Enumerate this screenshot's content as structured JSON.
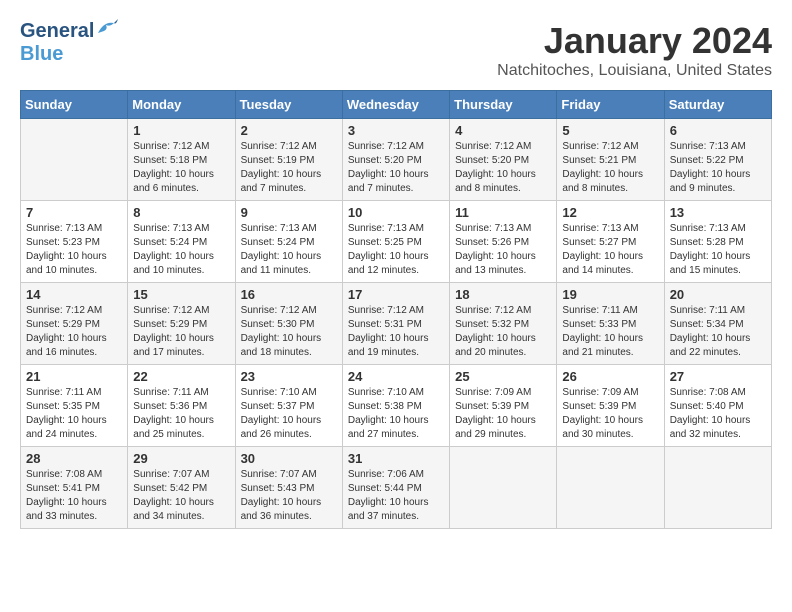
{
  "header": {
    "logo_general": "General",
    "logo_blue": "Blue",
    "month_title": "January 2024",
    "location": "Natchitoches, Louisiana, United States"
  },
  "weekdays": [
    "Sunday",
    "Monday",
    "Tuesday",
    "Wednesday",
    "Thursday",
    "Friday",
    "Saturday"
  ],
  "weeks": [
    [
      {
        "day": "",
        "info": ""
      },
      {
        "day": "1",
        "info": "Sunrise: 7:12 AM\nSunset: 5:18 PM\nDaylight: 10 hours\nand 6 minutes."
      },
      {
        "day": "2",
        "info": "Sunrise: 7:12 AM\nSunset: 5:19 PM\nDaylight: 10 hours\nand 7 minutes."
      },
      {
        "day": "3",
        "info": "Sunrise: 7:12 AM\nSunset: 5:20 PM\nDaylight: 10 hours\nand 7 minutes."
      },
      {
        "day": "4",
        "info": "Sunrise: 7:12 AM\nSunset: 5:20 PM\nDaylight: 10 hours\nand 8 minutes."
      },
      {
        "day": "5",
        "info": "Sunrise: 7:12 AM\nSunset: 5:21 PM\nDaylight: 10 hours\nand 8 minutes."
      },
      {
        "day": "6",
        "info": "Sunrise: 7:13 AM\nSunset: 5:22 PM\nDaylight: 10 hours\nand 9 minutes."
      }
    ],
    [
      {
        "day": "7",
        "info": "Sunrise: 7:13 AM\nSunset: 5:23 PM\nDaylight: 10 hours\nand 10 minutes."
      },
      {
        "day": "8",
        "info": "Sunrise: 7:13 AM\nSunset: 5:24 PM\nDaylight: 10 hours\nand 10 minutes."
      },
      {
        "day": "9",
        "info": "Sunrise: 7:13 AM\nSunset: 5:24 PM\nDaylight: 10 hours\nand 11 minutes."
      },
      {
        "day": "10",
        "info": "Sunrise: 7:13 AM\nSunset: 5:25 PM\nDaylight: 10 hours\nand 12 minutes."
      },
      {
        "day": "11",
        "info": "Sunrise: 7:13 AM\nSunset: 5:26 PM\nDaylight: 10 hours\nand 13 minutes."
      },
      {
        "day": "12",
        "info": "Sunrise: 7:13 AM\nSunset: 5:27 PM\nDaylight: 10 hours\nand 14 minutes."
      },
      {
        "day": "13",
        "info": "Sunrise: 7:13 AM\nSunset: 5:28 PM\nDaylight: 10 hours\nand 15 minutes."
      }
    ],
    [
      {
        "day": "14",
        "info": "Sunrise: 7:12 AM\nSunset: 5:29 PM\nDaylight: 10 hours\nand 16 minutes."
      },
      {
        "day": "15",
        "info": "Sunrise: 7:12 AM\nSunset: 5:29 PM\nDaylight: 10 hours\nand 17 minutes."
      },
      {
        "day": "16",
        "info": "Sunrise: 7:12 AM\nSunset: 5:30 PM\nDaylight: 10 hours\nand 18 minutes."
      },
      {
        "day": "17",
        "info": "Sunrise: 7:12 AM\nSunset: 5:31 PM\nDaylight: 10 hours\nand 19 minutes."
      },
      {
        "day": "18",
        "info": "Sunrise: 7:12 AM\nSunset: 5:32 PM\nDaylight: 10 hours\nand 20 minutes."
      },
      {
        "day": "19",
        "info": "Sunrise: 7:11 AM\nSunset: 5:33 PM\nDaylight: 10 hours\nand 21 minutes."
      },
      {
        "day": "20",
        "info": "Sunrise: 7:11 AM\nSunset: 5:34 PM\nDaylight: 10 hours\nand 22 minutes."
      }
    ],
    [
      {
        "day": "21",
        "info": "Sunrise: 7:11 AM\nSunset: 5:35 PM\nDaylight: 10 hours\nand 24 minutes."
      },
      {
        "day": "22",
        "info": "Sunrise: 7:11 AM\nSunset: 5:36 PM\nDaylight: 10 hours\nand 25 minutes."
      },
      {
        "day": "23",
        "info": "Sunrise: 7:10 AM\nSunset: 5:37 PM\nDaylight: 10 hours\nand 26 minutes."
      },
      {
        "day": "24",
        "info": "Sunrise: 7:10 AM\nSunset: 5:38 PM\nDaylight: 10 hours\nand 27 minutes."
      },
      {
        "day": "25",
        "info": "Sunrise: 7:09 AM\nSunset: 5:39 PM\nDaylight: 10 hours\nand 29 minutes."
      },
      {
        "day": "26",
        "info": "Sunrise: 7:09 AM\nSunset: 5:39 PM\nDaylight: 10 hours\nand 30 minutes."
      },
      {
        "day": "27",
        "info": "Sunrise: 7:08 AM\nSunset: 5:40 PM\nDaylight: 10 hours\nand 32 minutes."
      }
    ],
    [
      {
        "day": "28",
        "info": "Sunrise: 7:08 AM\nSunset: 5:41 PM\nDaylight: 10 hours\nand 33 minutes."
      },
      {
        "day": "29",
        "info": "Sunrise: 7:07 AM\nSunset: 5:42 PM\nDaylight: 10 hours\nand 34 minutes."
      },
      {
        "day": "30",
        "info": "Sunrise: 7:07 AM\nSunset: 5:43 PM\nDaylight: 10 hours\nand 36 minutes."
      },
      {
        "day": "31",
        "info": "Sunrise: 7:06 AM\nSunset: 5:44 PM\nDaylight: 10 hours\nand 37 minutes."
      },
      {
        "day": "",
        "info": ""
      },
      {
        "day": "",
        "info": ""
      },
      {
        "day": "",
        "info": ""
      }
    ]
  ]
}
